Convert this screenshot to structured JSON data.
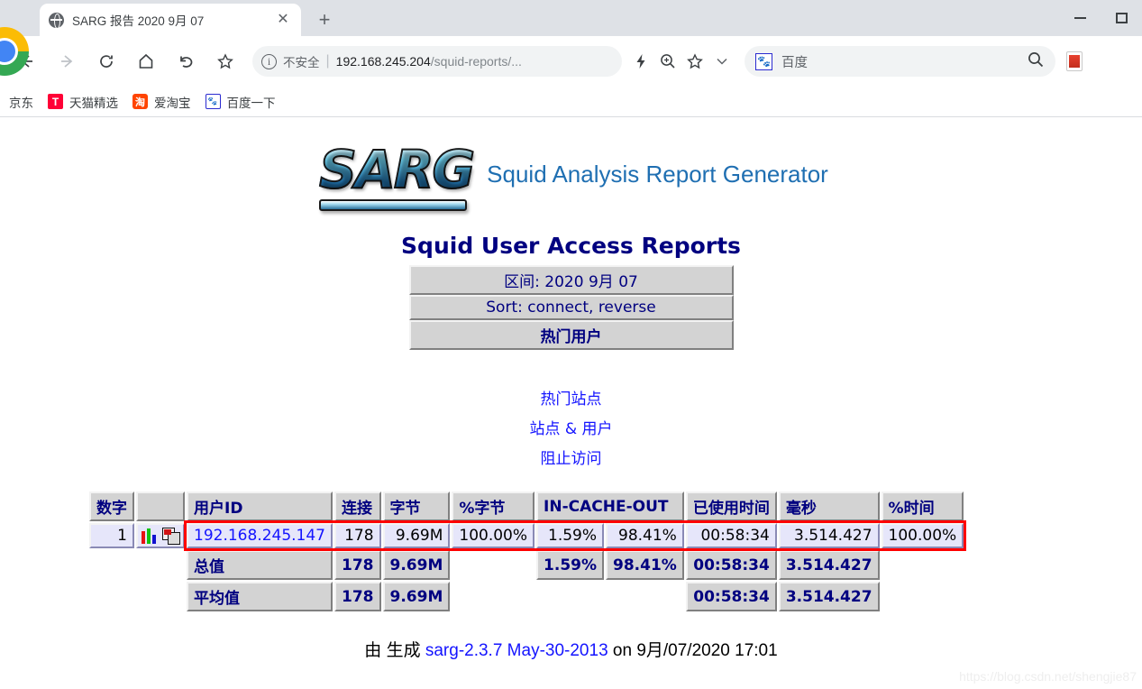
{
  "browser": {
    "tab": {
      "title": "SARG 报告 2020 9月 07",
      "favicon": "globe-icon",
      "close": "✕"
    },
    "newtab_label": "+",
    "nav": {
      "back": "back-arrow-icon",
      "forward": "forward-arrow-icon",
      "reload": "reload-icon",
      "home": "home-icon",
      "history_back": "undo-icon",
      "bookmark": "star-icon"
    },
    "omnibox": {
      "security_label": "不安全",
      "separator": "|",
      "url_host": "192.168.245.204",
      "url_path": "/squid-reports/...",
      "icons": [
        "lightning-icon",
        "zoom-icon",
        "star-icon",
        "chevron-down-icon"
      ]
    },
    "search": {
      "engine_icon": "baidu-paw-icon",
      "placeholder": "百度",
      "submit_icon": "search-icon"
    },
    "extensions": [
      "pdf-extension-icon"
    ],
    "window": {
      "minimize": "minimize-icon",
      "maximize": "maximize-icon"
    },
    "bookmarks": [
      {
        "label": "京东",
        "icon": "jd-icon"
      },
      {
        "label": "天猫精选",
        "icon": "tmall-icon"
      },
      {
        "label": "爱淘宝",
        "icon": "taobao-icon"
      },
      {
        "label": "百度一下",
        "icon": "baidu-icon"
      }
    ]
  },
  "report": {
    "logo_text": "SARG",
    "logo_subtitle": "Squid Analysis Report Generator",
    "heading": "Squid User Access Reports",
    "info_rows": [
      {
        "text": "区间: 2020 9月 07",
        "bold": false
      },
      {
        "text": "Sort: connect, reverse",
        "bold": false
      },
      {
        "text": "热门用户",
        "bold": true
      }
    ],
    "links": [
      "热门站点",
      "站点 & 用户",
      "阻止访问"
    ],
    "table": {
      "headers": [
        "数字",
        "",
        "用户ID",
        "连接",
        "字节",
        "%字节",
        "IN-CACHE-OUT",
        "已使用时间",
        "毫秒",
        "%时间"
      ],
      "rows": [
        {
          "num": "1",
          "icons": [
            "bar-chart-icon",
            "download-report-icon"
          ],
          "userid": "192.168.245.147",
          "connect": "178",
          "bytes": "9.69M",
          "pct_bytes": "100.00%",
          "in_cache": "1.59%",
          "cache_out": "98.41%",
          "elapsed": "00:58:34",
          "millisec": "3.514.427",
          "pct_time": "100.00%"
        }
      ],
      "total_row": {
        "label": "总值",
        "connect": "178",
        "bytes": "9.69M",
        "pct_bytes": "",
        "in_cache": "1.59%",
        "cache_out": "98.41%",
        "elapsed": "00:58:34",
        "millisec": "3.514.427",
        "pct_time": ""
      },
      "average_row": {
        "label": "平均值",
        "connect": "178",
        "bytes": "9.69M",
        "pct_bytes": "",
        "in_cache": "",
        "cache_out": "",
        "elapsed": "00:58:34",
        "millisec": "3.514.427",
        "pct_time": ""
      }
    },
    "footer": {
      "prefix": "由 生成 ",
      "version_link": "sarg-2.3.7 May-30-2013",
      "suffix": " on 9月/07/2020 17:01"
    },
    "watermark": "https://blog.csdn.net/shengjie87",
    "colors": {
      "heading": "#000080",
      "link": "#1414ff",
      "header_bg": "#d3d3d3",
      "cell_bg": "#e6e6fa",
      "highlight": "#ff0000",
      "logo_sub": "#1f6fb2"
    }
  }
}
